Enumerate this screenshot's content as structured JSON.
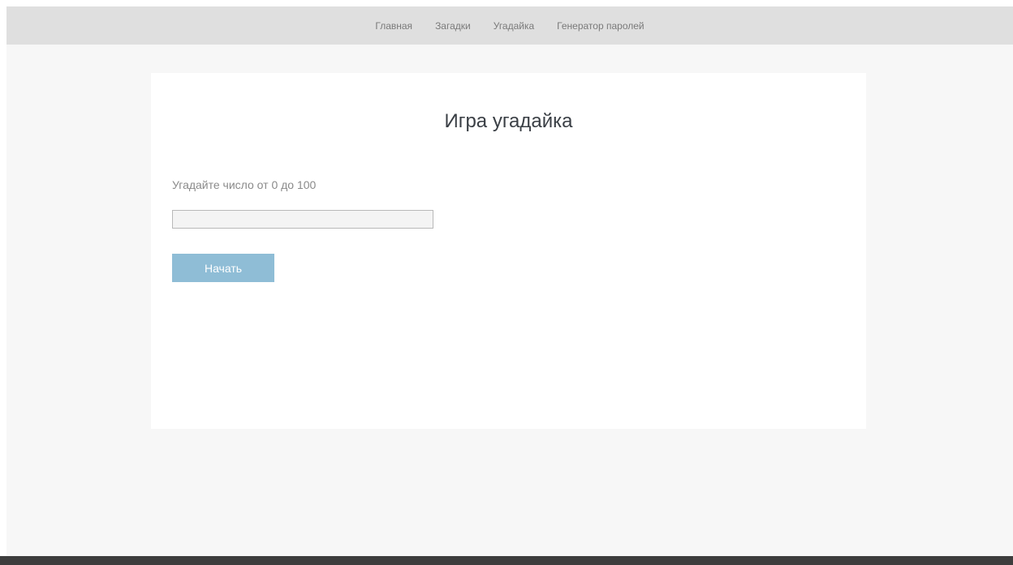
{
  "nav": {
    "items": [
      {
        "label": "Главная"
      },
      {
        "label": "Загадки"
      },
      {
        "label": "Угадайка"
      },
      {
        "label": "Генератор паролей"
      }
    ]
  },
  "game": {
    "title": "Игра угадайка",
    "prompt": "Угадайте число от 0 до 100",
    "input_value": "",
    "start_label": "Начать"
  },
  "colors": {
    "nav_bg": "#dfdfdf",
    "page_bg": "#f7f7f7",
    "button_bg": "#8fbdd6",
    "footer_bg": "#3d3d3d"
  }
}
